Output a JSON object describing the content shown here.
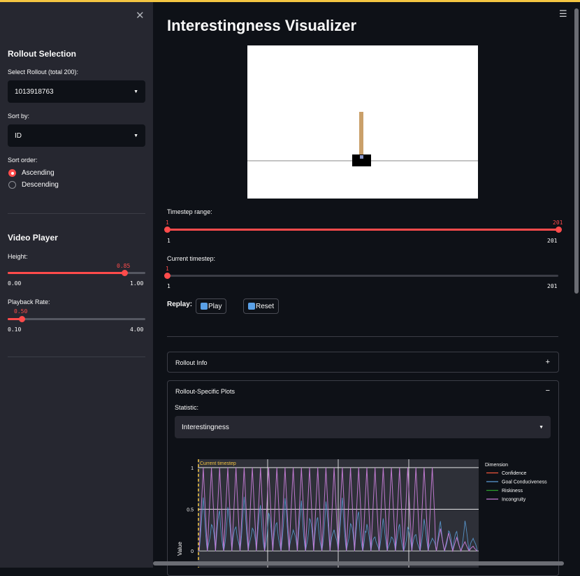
{
  "sidebar": {
    "close_icon": "close-icon",
    "rollout_section": "Rollout Selection",
    "select_rollout_label": "Select Rollout (total 200):",
    "select_rollout_value": "1013918763",
    "sort_by_label": "Sort by:",
    "sort_by_value": "ID",
    "sort_order_label": "Sort order:",
    "sort_order_options": [
      "Ascending",
      "Descending"
    ],
    "sort_order_selected": "Ascending",
    "video_section": "Video Player",
    "height": {
      "label": "Height:",
      "value": "0.85",
      "min": "0.00",
      "max": "1.00",
      "fraction": 0.85
    },
    "playback": {
      "label": "Playback Rate:",
      "value": "0.50",
      "min": "0.10",
      "max": "4.00",
      "fraction": 0.103
    }
  },
  "main": {
    "menu_icon": "hamburger-icon",
    "title": "Interestingness Visualizer",
    "timestep_range": {
      "label": "Timestep range:",
      "low": "1",
      "high": "201",
      "min": "1",
      "max": "201"
    },
    "current_timestep": {
      "label": "Current timestep:",
      "value": "1",
      "min": "1",
      "max": "201"
    },
    "replay_label": "Replay:",
    "play_label": "Play",
    "reset_label": "Reset",
    "rollout_info": {
      "title": "Rollout Info",
      "sign": "+"
    },
    "rollout_plots": {
      "title": "Rollout-Specific Plots",
      "sign": "−"
    },
    "statistic_label": "Statistic:",
    "statistic_value": "Interestingness"
  },
  "chart_data": {
    "type": "line",
    "title": "",
    "xlabel": "",
    "ylabel": "Value",
    "y_ticks": [
      "1",
      "0.5",
      "0"
    ],
    "ylim": [
      -0.2,
      1.1
    ],
    "annotation": "Current timestep",
    "legend_title": "Dimension",
    "legend_placement": "right",
    "series": [
      {
        "name": "Confidence",
        "color": "#ef553b"
      },
      {
        "name": "Goal Conduciveness",
        "color": "#5b9bd5"
      },
      {
        "name": "Riskiness",
        "color": "#2ca02c"
      },
      {
        "name": "Incongruity",
        "color": "#c77dd7"
      }
    ]
  }
}
